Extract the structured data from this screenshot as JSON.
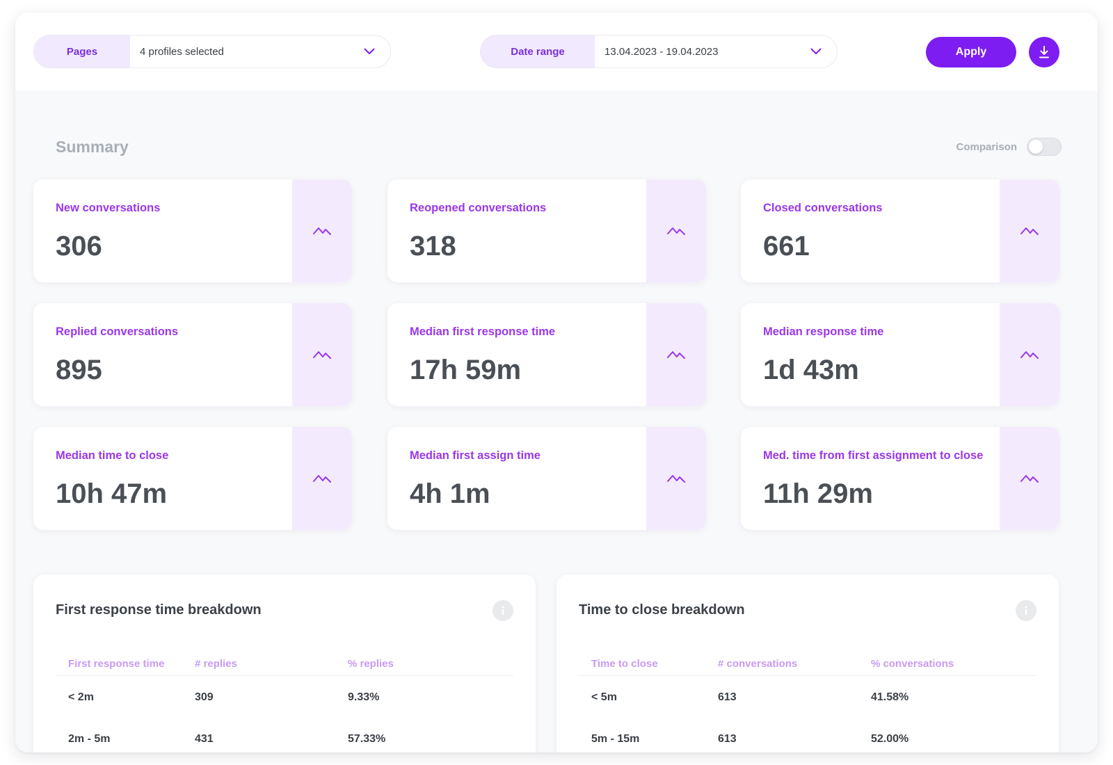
{
  "filters": {
    "pages_label": "Pages",
    "pages_value": "4 profiles selected",
    "date_label": "Date range",
    "date_value": "13.04.2023 - 19.04.2023"
  },
  "actions": {
    "apply_label": "Apply",
    "download_icon": "download-icon",
    "accent_color": "#7d1df2"
  },
  "summary": {
    "title": "Summary",
    "comparison_label": "Comparison",
    "comparison_enabled": false,
    "cards": [
      {
        "title": "New conversations",
        "value": "306"
      },
      {
        "title": "Reopened conversations",
        "value": "318"
      },
      {
        "title": "Closed conversations",
        "value": "661"
      },
      {
        "title": "Replied conversations",
        "value": "895"
      },
      {
        "title": "Median first response time",
        "value": "17h 59m"
      },
      {
        "title": "Median response time",
        "value": "1d 43m"
      },
      {
        "title": "Median time to close",
        "value": "10h 47m"
      },
      {
        "title": "Median first assign time",
        "value": "4h 1m"
      },
      {
        "title": "Med. time from first assignment to close",
        "value": "11h 29m"
      }
    ],
    "card_icon": "trend-line-icon"
  },
  "first_response": {
    "title": "First response time breakdown",
    "columns": [
      "First response time",
      "# replies",
      "% replies"
    ],
    "rows": [
      [
        "< 2m",
        "309",
        "9.33%"
      ],
      [
        "2m - 5m",
        "431",
        "57.33%"
      ]
    ]
  },
  "time_to_close": {
    "title": "Time to close breakdown",
    "columns": [
      "Time to close",
      "# conversations",
      "% conversations"
    ],
    "rows": [
      [
        "< 5m",
        "613",
        "41.58%"
      ],
      [
        "5m - 15m",
        "613",
        "52.00%"
      ]
    ]
  }
}
